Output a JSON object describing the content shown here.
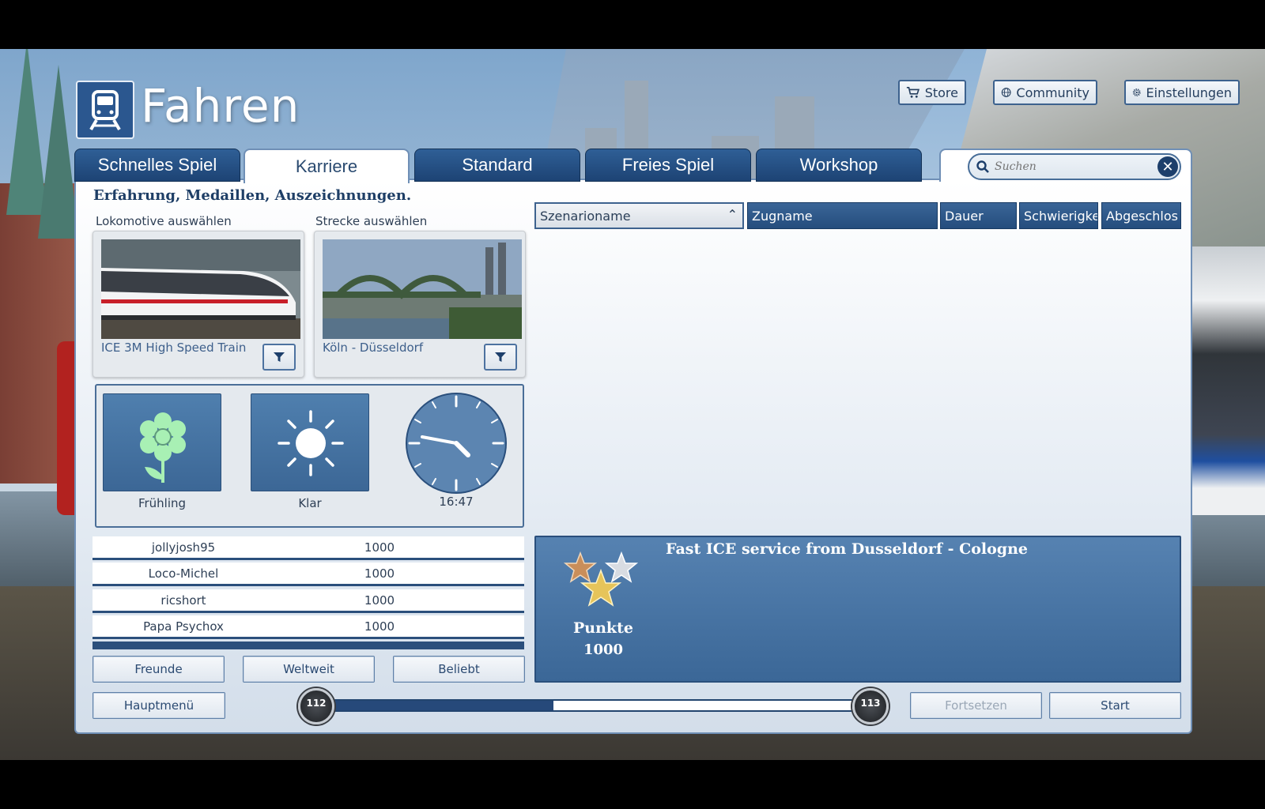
{
  "header": {
    "title": "Fahren",
    "buttons": {
      "store": "Store",
      "community": "Community",
      "settings": "Einstellungen"
    }
  },
  "tabs": [
    {
      "label": "Schnelles Spiel",
      "active": false
    },
    {
      "label": "Karriere",
      "active": true
    },
    {
      "label": "Standard",
      "active": false
    },
    {
      "label": "Freies Spiel",
      "active": false
    },
    {
      "label": "Workshop",
      "active": false
    }
  ],
  "search": {
    "placeholder": "Suchen",
    "value": ""
  },
  "left": {
    "section_title": "Erfahrung, Medaillen, Auszeichnungen.",
    "loco": {
      "label": "Lokomotive auswählen",
      "name": "ICE 3M High Speed Train"
    },
    "route": {
      "label": "Strecke auswählen",
      "name": "Köln - Düsseldorf"
    },
    "conditions": {
      "season": "Frühling",
      "weather": "Klar",
      "time": "16:47"
    },
    "leaderboard": [
      {
        "name": "jollyjosh95",
        "score": "1000"
      },
      {
        "name": "Loco-Michel",
        "score": "1000"
      },
      {
        "name": "ricshort",
        "score": "1000"
      },
      {
        "name": "Papa Psychox",
        "score": "1000"
      }
    ],
    "filters": {
      "friends": "Freunde",
      "worldwide": "Weltweit",
      "popular": "Beliebt"
    },
    "main_menu": "Hauptmenü"
  },
  "table": {
    "columns": [
      "Szenarioname",
      "Zugname",
      "Dauer",
      "Schwierigke",
      "Abgeschlos"
    ],
    "sort_column": "Szenarioname",
    "rows": []
  },
  "detail": {
    "title": "Fast ICE service from Dusseldorf - Cologne",
    "points_label": "Punkte",
    "points": "1000",
    "medals": [
      "bronze",
      "silver",
      "gold"
    ]
  },
  "progress": {
    "level_current": "112",
    "level_next": "113",
    "fraction": 0.42
  },
  "actions": {
    "continue": "Fortsetzen",
    "start": "Start"
  },
  "colors": {
    "accent": "#2b578f",
    "tab_blue": "#1d4374",
    "season_flower": "#a8f0b4",
    "gold": "#e6c45a",
    "silver": "#d8dce2",
    "bronze": "#c98e5a"
  }
}
